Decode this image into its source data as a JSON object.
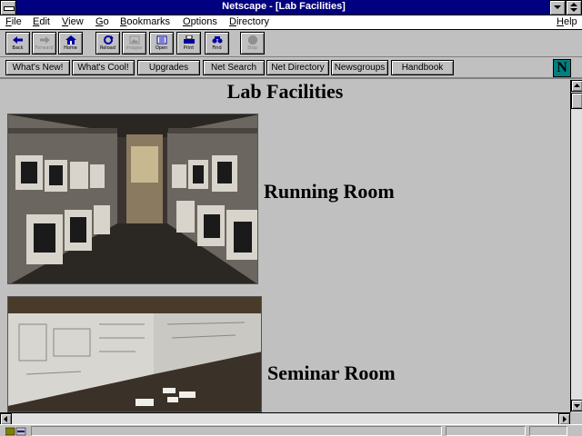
{
  "window": {
    "title": "Netscape - [Lab Facilities]"
  },
  "menubar": {
    "items": [
      "File",
      "Edit",
      "View",
      "Go",
      "Bookmarks",
      "Options",
      "Directory"
    ],
    "help": "Help"
  },
  "toolbar": {
    "buttons": [
      {
        "label": "Back",
        "icon": "back-arrow-icon",
        "enabled": true
      },
      {
        "label": "Forward",
        "icon": "forward-arrow-icon",
        "enabled": false
      },
      {
        "label": "Home",
        "icon": "home-icon",
        "enabled": true
      },
      {
        "label": "Reload",
        "icon": "reload-icon",
        "enabled": true
      },
      {
        "label": "Images",
        "icon": "images-icon",
        "enabled": false
      },
      {
        "label": "Open",
        "icon": "open-icon",
        "enabled": true
      },
      {
        "label": "Print",
        "icon": "print-icon",
        "enabled": true
      },
      {
        "label": "Find",
        "icon": "find-icon",
        "enabled": true
      },
      {
        "label": "Stop",
        "icon": "stop-icon",
        "enabled": false
      }
    ]
  },
  "directory_buttons": [
    "What's New!",
    "What's Cool!",
    "Upgrades",
    "Net Search",
    "Net Directory",
    "Newsgroups",
    "Handbook"
  ],
  "logo": {
    "letter": "N",
    "color": "#008080"
  },
  "page": {
    "heading": "Lab Facilities",
    "sections": [
      {
        "caption": "Running Room",
        "image": "running-room-photo"
      },
      {
        "caption": "Seminar Room",
        "image": "seminar-room-photo"
      }
    ]
  },
  "colors": {
    "titlebar": "#000080",
    "background": "#c0c0c0"
  }
}
